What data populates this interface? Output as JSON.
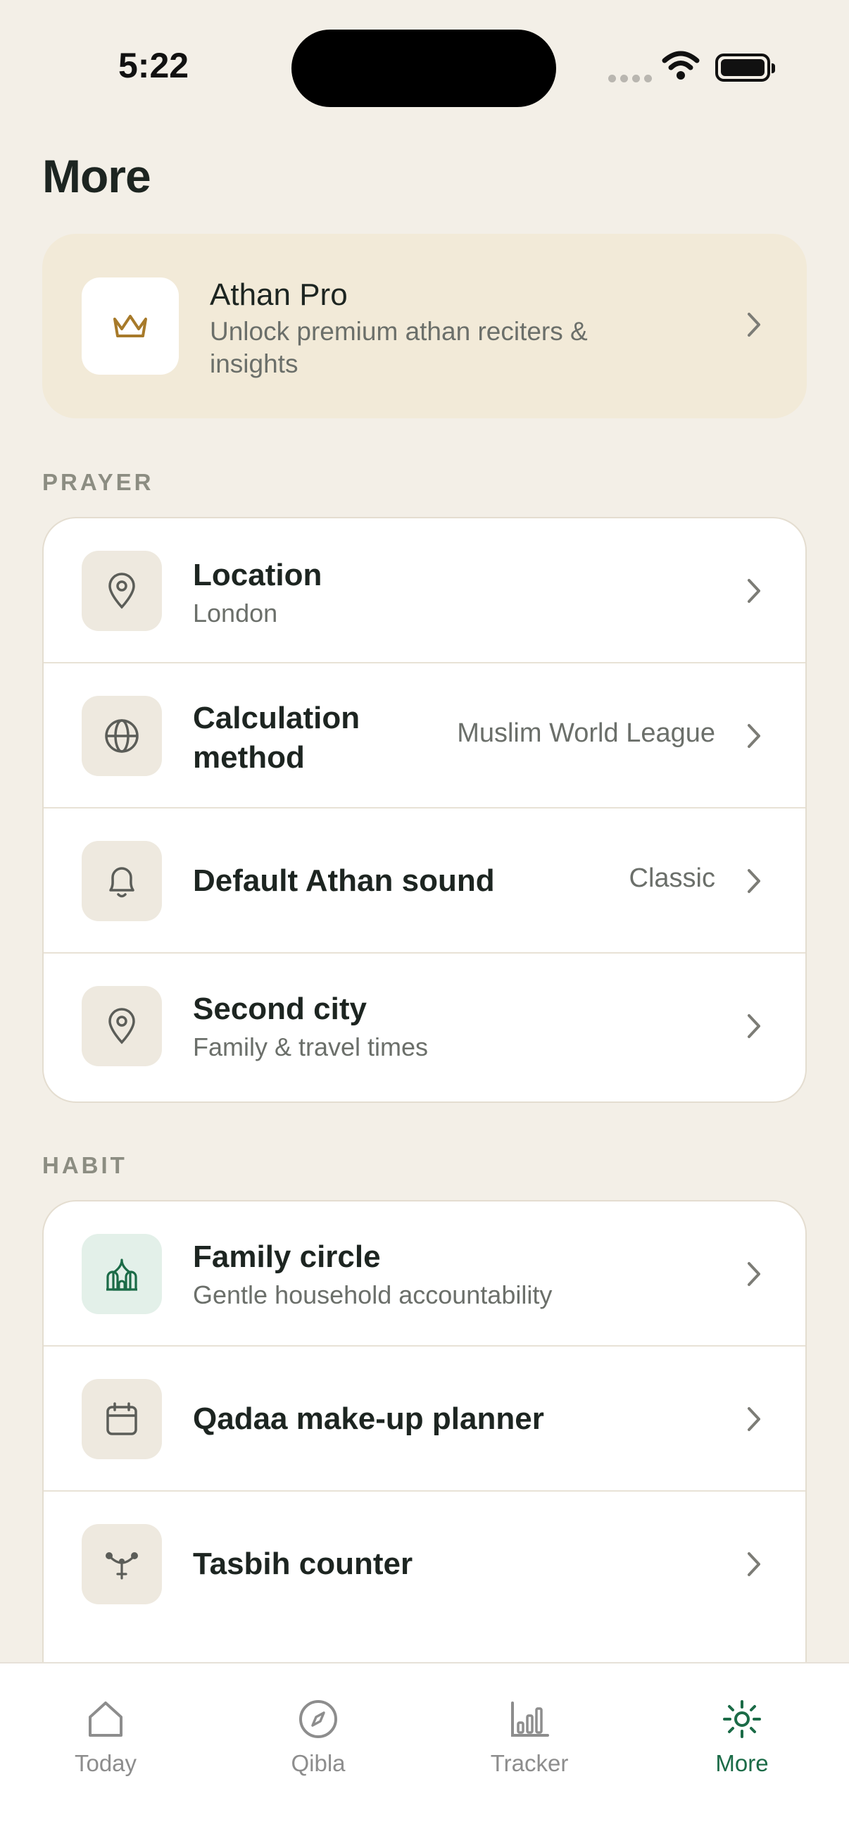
{
  "status_bar": {
    "time": "5:22"
  },
  "page": {
    "title": "More"
  },
  "pro": {
    "title": "Athan Pro",
    "subtitle": "Unlock premium athan reciters & insights",
    "icon": "crown-icon"
  },
  "sections": {
    "prayer": {
      "label": "PRAYER",
      "items": [
        {
          "title": "Location",
          "subtitle": "London",
          "icon": "map-pin-icon"
        },
        {
          "title": "Calculation method",
          "value": "Muslim World League",
          "icon": "globe-icon"
        },
        {
          "title": "Default Athan sound",
          "value": "Classic",
          "icon": "bell-icon"
        },
        {
          "title": "Second city",
          "subtitle": "Family & travel times",
          "icon": "map-pin-icon"
        }
      ]
    },
    "habit": {
      "label": "HABIT",
      "items": [
        {
          "title": "Family circle",
          "subtitle": "Gentle household accountability",
          "icon": "mosque-icon"
        },
        {
          "title": "Qadaa make-up planner",
          "icon": "calendar-icon"
        },
        {
          "title": "Tasbih counter",
          "icon": "tasbih-icon"
        }
      ]
    }
  },
  "tabs": [
    {
      "label": "Today",
      "icon": "home-icon",
      "active": false
    },
    {
      "label": "Qibla",
      "icon": "compass-icon",
      "active": false
    },
    {
      "label": "Tracker",
      "icon": "bar-chart-icon",
      "active": false
    },
    {
      "label": "More",
      "icon": "sun-icon",
      "active": true
    }
  ],
  "colors": {
    "accent": "#1b6b47",
    "background": "#f3efe7",
    "pro_card": "#f2ead8",
    "crown": "#a77a2a"
  }
}
